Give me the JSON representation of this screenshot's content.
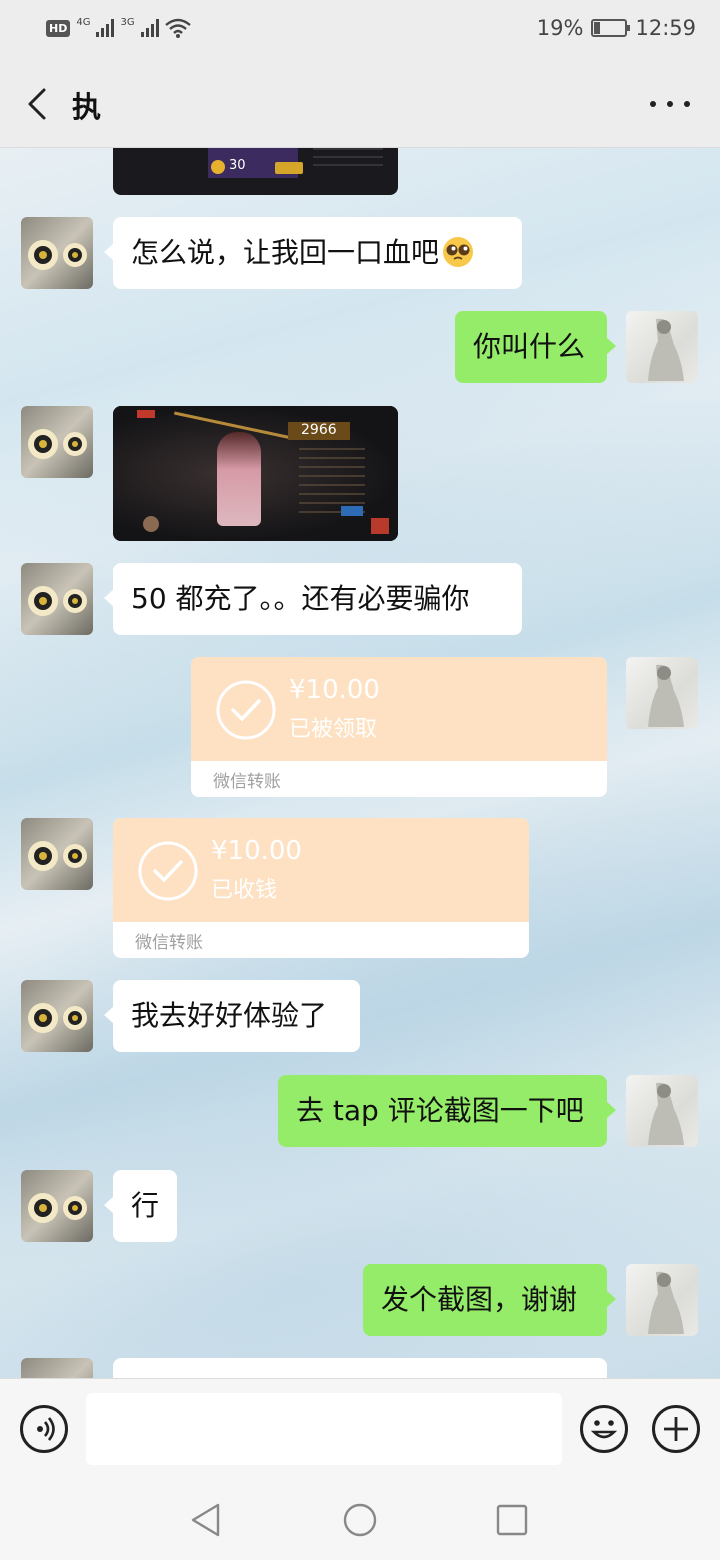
{
  "status_bar": {
    "hd": "HD",
    "sim1": "4G",
    "sim2": "3G",
    "battery": "19%",
    "battery_level": 0.19,
    "time": "12:59"
  },
  "header": {
    "title": "执",
    "back_icon": "chevron-left-icon",
    "more_icon": "more-dots-icon"
  },
  "messages": [
    {
      "side": "left",
      "type": "image",
      "desc_icon": "game-screenshot",
      "subtext": "30"
    },
    {
      "side": "left",
      "type": "text",
      "text": "怎么说，让我回一口血吧",
      "emoji": "pleading-face-icon"
    },
    {
      "side": "right",
      "type": "text",
      "text": "你叫什么"
    },
    {
      "side": "left",
      "type": "image",
      "desc_icon": "game-screenshot",
      "subtext": "2966"
    },
    {
      "side": "left",
      "type": "text",
      "text": "50 都充了。。还有必要骗你"
    },
    {
      "side": "right",
      "type": "transfer",
      "amount": "¥10.00",
      "status": "已被领取",
      "footer": "微信转账"
    },
    {
      "side": "left",
      "type": "transfer",
      "amount": "¥10.00",
      "status": "已收钱",
      "footer": "微信转账"
    },
    {
      "side": "left",
      "type": "text",
      "text": "我去好好体验了"
    },
    {
      "side": "right",
      "type": "text",
      "text": "去 tap 评论截图一下吧"
    },
    {
      "side": "left",
      "type": "text",
      "text": "行"
    },
    {
      "side": "right",
      "type": "text",
      "text": "发个截图，谢谢"
    }
  ],
  "input_bar": {
    "voice_icon": "voice-icon",
    "emoji_icon": "emoji-icon",
    "plus_icon": "plus-icon",
    "input_value": ""
  },
  "system_nav": {
    "back": "triangle-back-icon",
    "home": "circle-home-icon",
    "recents": "square-recents-icon"
  }
}
